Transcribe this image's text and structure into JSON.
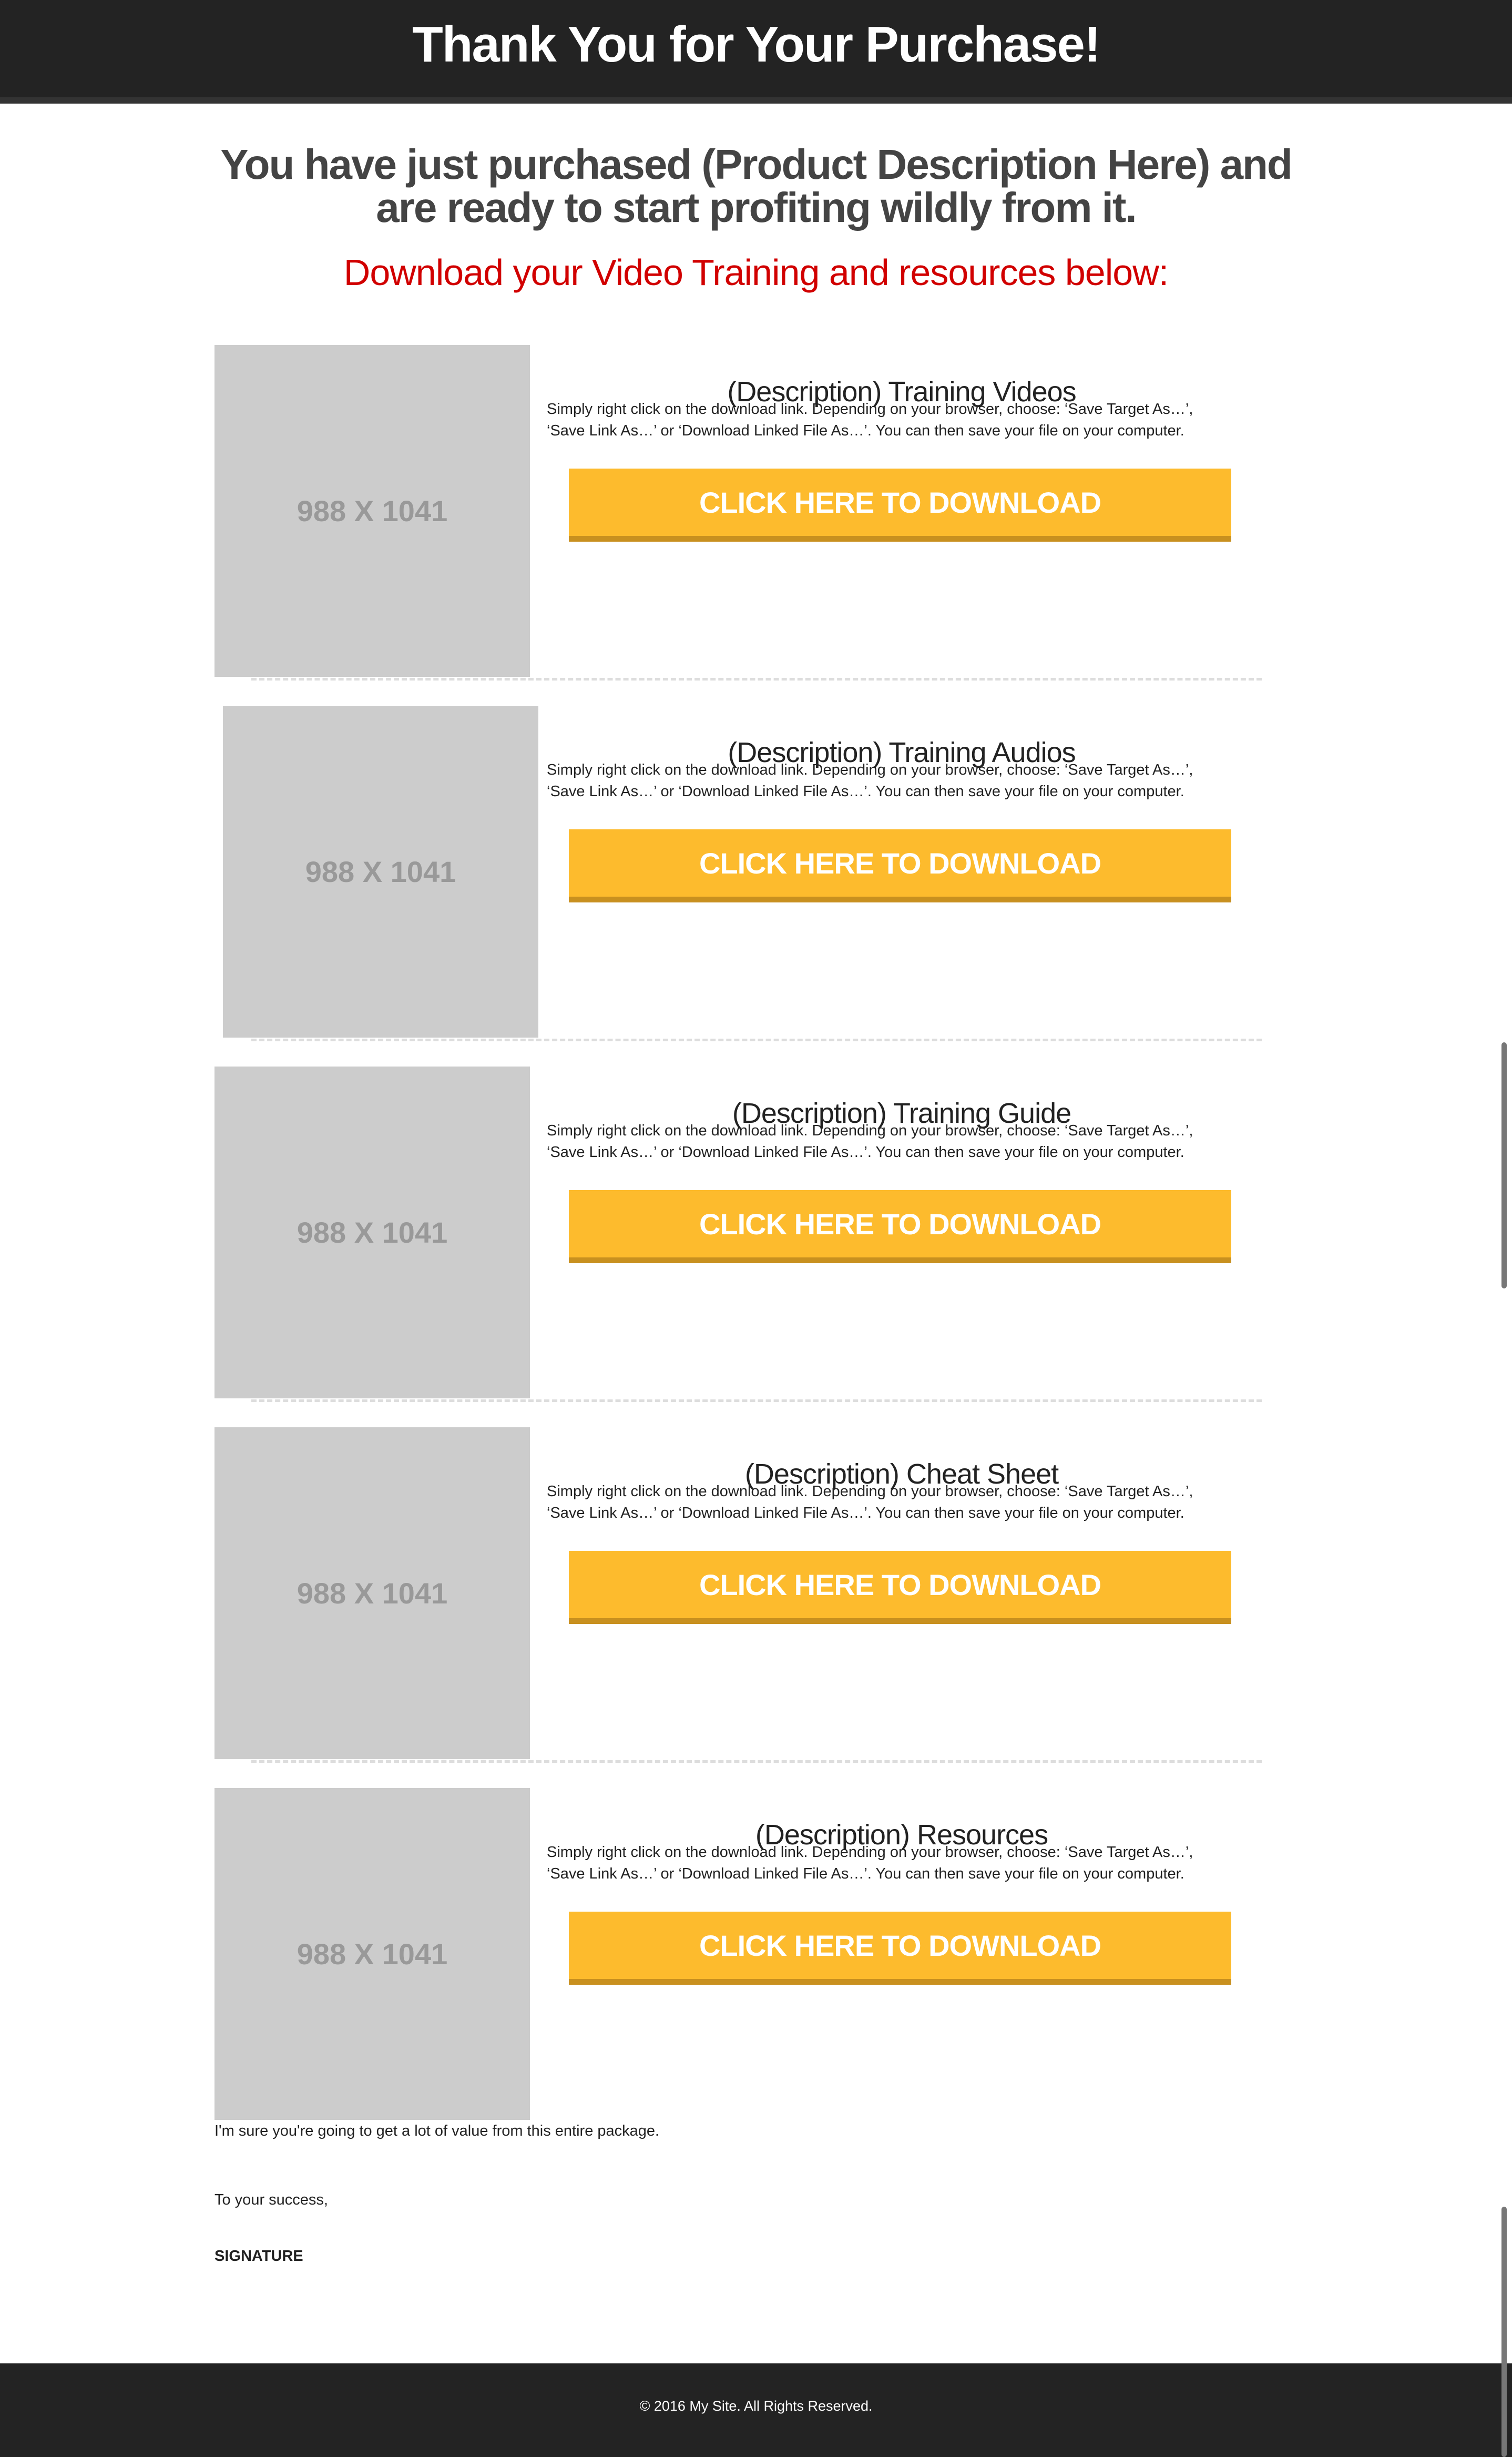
{
  "header": {
    "title": "Thank You for Your Purchase!"
  },
  "intro": {
    "headline_line1": "You have just purchased (Product Description Here) and",
    "headline_line2": "are ready to start profiting wildly from it.",
    "subheadline": "Download your Video Training and resources below:"
  },
  "colors": {
    "accent_red": "#d10000",
    "button": "#fdbb2d",
    "header_bg": "#232323"
  },
  "sections": [
    {
      "image_label": "988 X 1041",
      "title": "(Description) Training Videos",
      "desc_line1": "Simply right click on the download link. Depending on your browser, choose: ‘Save Target As…’,",
      "desc_line2": "‘Save Link As…’ or ‘Download Linked File As…’. You can then save your file on your computer.",
      "button": "CLICK HERE TO DOWNLOAD"
    },
    {
      "image_label": "988 X 1041",
      "title": "(Description) Training Audios",
      "desc_line1": "Simply right click on the download link. Depending on your browser, choose: ‘Save Target As…’,",
      "desc_line2": "‘Save Link As…’ or ‘Download Linked File As…’. You can then save your file on your computer.",
      "button": "CLICK HERE TO DOWNLOAD"
    },
    {
      "image_label": "988 X 1041",
      "title": "(Description) Training Guide",
      "desc_line1": "Simply right click on the download link. Depending on your browser, choose: ‘Save Target As…’,",
      "desc_line2": "‘Save Link As…’ or ‘Download Linked File As…’. You can then save your file on your computer.",
      "button": "CLICK HERE TO DOWNLOAD"
    },
    {
      "image_label": "988 X 1041",
      "title": "(Description) Cheat Sheet",
      "desc_line1": "Simply right click on the download link. Depending on your browser, choose: ‘Save Target As…’,",
      "desc_line2": "‘Save Link As…’ or ‘Download Linked File As…’. You can then save your file on your computer.",
      "button": "CLICK HERE TO DOWNLOAD"
    },
    {
      "image_label": "988 X 1041",
      "title": "(Description) Resources",
      "desc_line1": "Simply right click on the download link. Depending on your browser, choose: ‘Save Target As…’,",
      "desc_line2": "‘Save Link As…’ or ‘Download Linked File As…’. You can then save your file on your computer.",
      "button": "CLICK HERE TO DOWNLOAD"
    }
  ],
  "closing": {
    "value_text": "I'm sure you're going to get a lot of value from this entire package.",
    "signoff": "To your success,",
    "signature": "SIGNATURE"
  },
  "footer": {
    "copyright": "© 2016 My Site. All Rights Reserved."
  }
}
